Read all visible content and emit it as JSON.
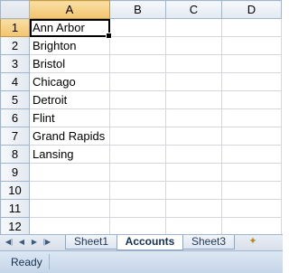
{
  "columns": [
    "A",
    "B",
    "C",
    "D"
  ],
  "rows": [
    "1",
    "2",
    "3",
    "4",
    "5",
    "6",
    "7",
    "8",
    "9",
    "10",
    "11",
    "12"
  ],
  "cells_a": [
    "Ann Arbor",
    "Brighton",
    "Bristol",
    "Chicago",
    "Detroit",
    "Flint",
    "Grand Rapids",
    "Lansing",
    "",
    "",
    "",
    ""
  ],
  "active_cell": "A1",
  "tabs": [
    "Sheet1",
    "Accounts",
    "Sheet3"
  ],
  "active_tab": "Accounts",
  "nav_icons": [
    "first-sheet-icon",
    "prev-sheet-icon",
    "next-sheet-icon",
    "last-sheet-icon"
  ],
  "status": "Ready",
  "colors": {
    "header_border": "#9eb6ce",
    "selected_header": "#f2c46e",
    "grid": "#d4d7dc"
  }
}
